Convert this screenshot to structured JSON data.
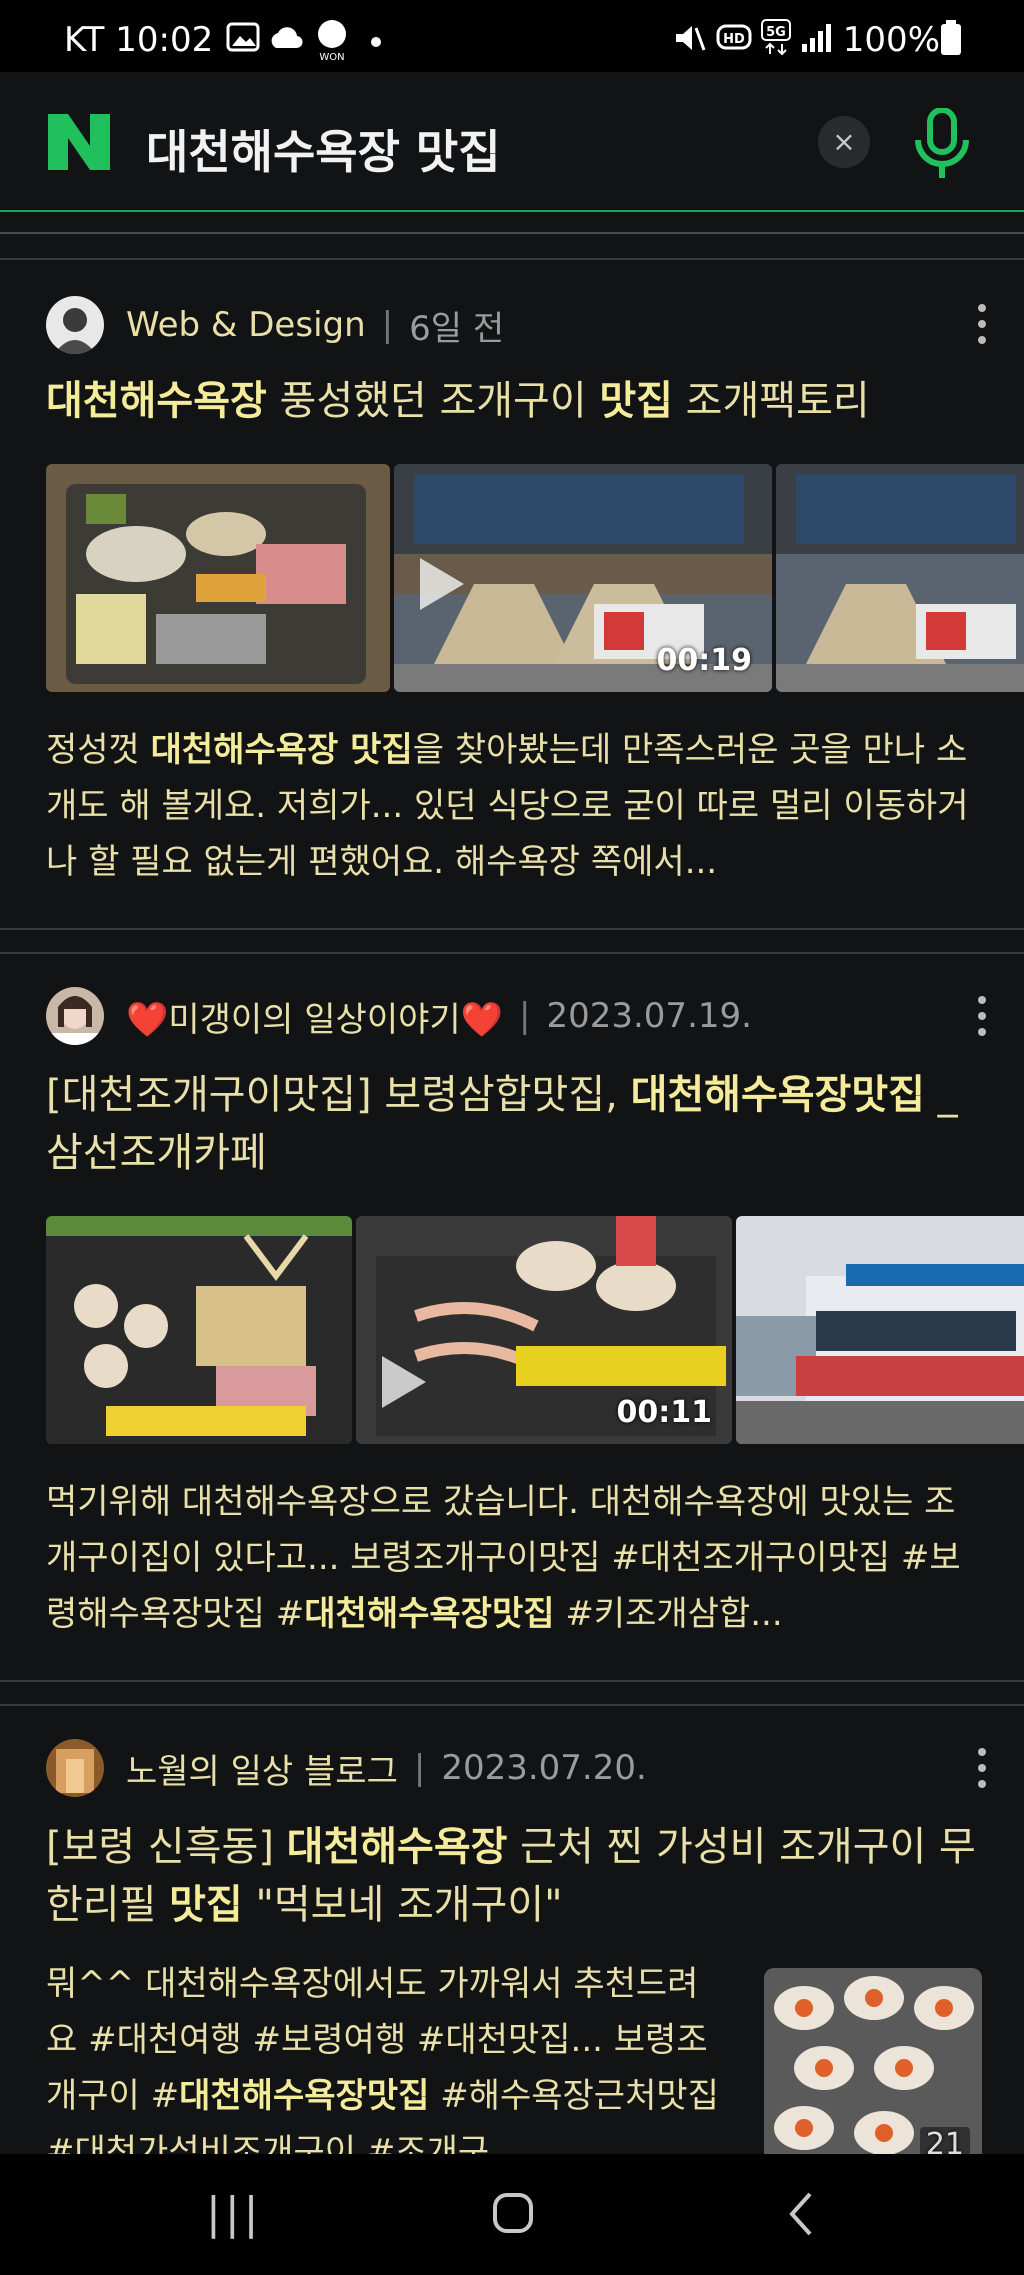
{
  "status": {
    "time": "KT 10:02",
    "battery": "100%",
    "icons": [
      "gallery-icon",
      "cloud-icon",
      "won-icon",
      "dot-icon",
      "mute-icon",
      "hd-icon",
      "5g-icon",
      "signal-icon",
      "battery-icon"
    ]
  },
  "search": {
    "logo": "N",
    "query": "대천해수욕장 맛집",
    "clear_icon": "×",
    "accent": "#20c05c"
  },
  "posts": [
    {
      "author": "Web & Design",
      "date": "6일 전",
      "title_parts": [
        {
          "text": "대천해수욕장",
          "bold": true
        },
        {
          "text": " 풍성했던 조개구이 ",
          "bold": false
        },
        {
          "text": "맛집",
          "bold": true
        },
        {
          "text": " 조개팩토리",
          "bold": false
        }
      ],
      "video_duration": "00:19",
      "snippet_parts": [
        {
          "text": "정성껏 ",
          "bold": false
        },
        {
          "text": "대천해수욕장 맛집",
          "bold": true
        },
        {
          "text": "을 찾아봤는데 만족스러운 곳을 만나 소개도 해 볼게요. 저희가... 있던 식당으로 굳이 따로 멀리 이동하거나 할 필요 없는게 편했어요. 해수욕장 쪽에서...",
          "bold": false
        }
      ]
    },
    {
      "author": "❤️미갱이의 일상이야기❤️",
      "date": "2023.07.19.",
      "title_parts": [
        {
          "text": "[대천조개구이맛집] 보령삼합맛집, ",
          "bold": false
        },
        {
          "text": "대천해수욕장맛집",
          "bold": true
        },
        {
          "text": " _ 삼선조개카페",
          "bold": false
        }
      ],
      "video_duration": "00:11",
      "snippet_parts": [
        {
          "text": "먹기위해 대천해수욕장으로 갔습니다. 대천해수욕장에 맛있는 조개구이집이 있다고... 보령조개구이맛집 #대천조개구이맛집 #보령해수욕장맛집 #",
          "bold": false
        },
        {
          "text": "대천해수욕장맛집",
          "bold": true
        },
        {
          "text": " #키조개삼합...",
          "bold": false
        }
      ]
    },
    {
      "author": "노월의 일상 블로그",
      "date": "2023.07.20.",
      "title_parts": [
        {
          "text": "[보령 신흑동] ",
          "bold": false
        },
        {
          "text": "대천해수욕장",
          "bold": true
        },
        {
          "text": " 근처 찐 가성비 조개구이 무한리필 ",
          "bold": false
        },
        {
          "text": "맛집",
          "bold": true
        },
        {
          "text": " \"먹보네 조개구이\"",
          "bold": false
        }
      ],
      "thumb_count": "21",
      "snippet_parts": [
        {
          "text": "뭐^^ 대천해수욕장에서도 가까워서 추천드려요 #대천여행 #보령여행 #대천맛집... 보령조개구이 #",
          "bold": false
        },
        {
          "text": "대천해수욕장맛집",
          "bold": true
        },
        {
          "text": " #해수욕장근처맛집 #대천가성비조개구이 #조개구...",
          "bold": false
        }
      ]
    }
  ],
  "navbar": {
    "recent": "|||",
    "home": "○",
    "back": "<"
  }
}
